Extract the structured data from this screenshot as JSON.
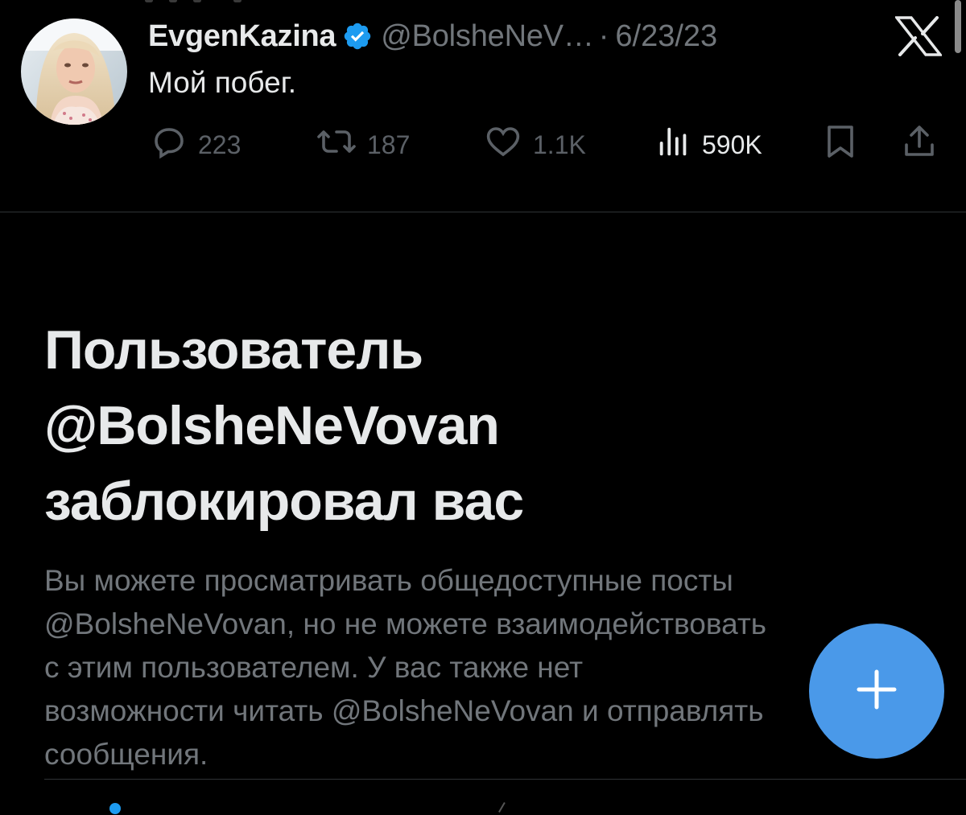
{
  "tweet": {
    "display_name": "EvgenKazina",
    "handle": "@BolsheNeV…",
    "separator": "·",
    "date": "6/23/23",
    "text": "Мой побег.",
    "actions": {
      "replies": "223",
      "reposts": "187",
      "likes": "1.1K",
      "views": "590K"
    }
  },
  "blocked": {
    "title_lines": [
      "Пользователь",
      "@BolsheNeVovan",
      "заблокировал вас"
    ],
    "description_lines": [
      "Вы можете просматривать общедоступные посты",
      "@BolsheNeVovan, но не можете взаимодействовать",
      "с этим пользователем. У вас также нет",
      "возможности читать @BolsheNeVovan и отправлять",
      "сообщения."
    ]
  },
  "fab": {
    "icon": "plus-icon",
    "color": "#4a99e9"
  },
  "colors": {
    "background": "#000000",
    "primary_text": "#e7e9ea",
    "secondary_text": "#71767b",
    "verified": "#1d9bf0",
    "accent": "#4a99e9"
  },
  "icons": {
    "verified": "verified-badge-icon",
    "close": "x-logo-icon",
    "reply": "reply-icon",
    "repost": "repost-icon",
    "like": "heart-icon",
    "views": "views-icon",
    "bookmark": "bookmark-icon",
    "share": "share-icon"
  }
}
